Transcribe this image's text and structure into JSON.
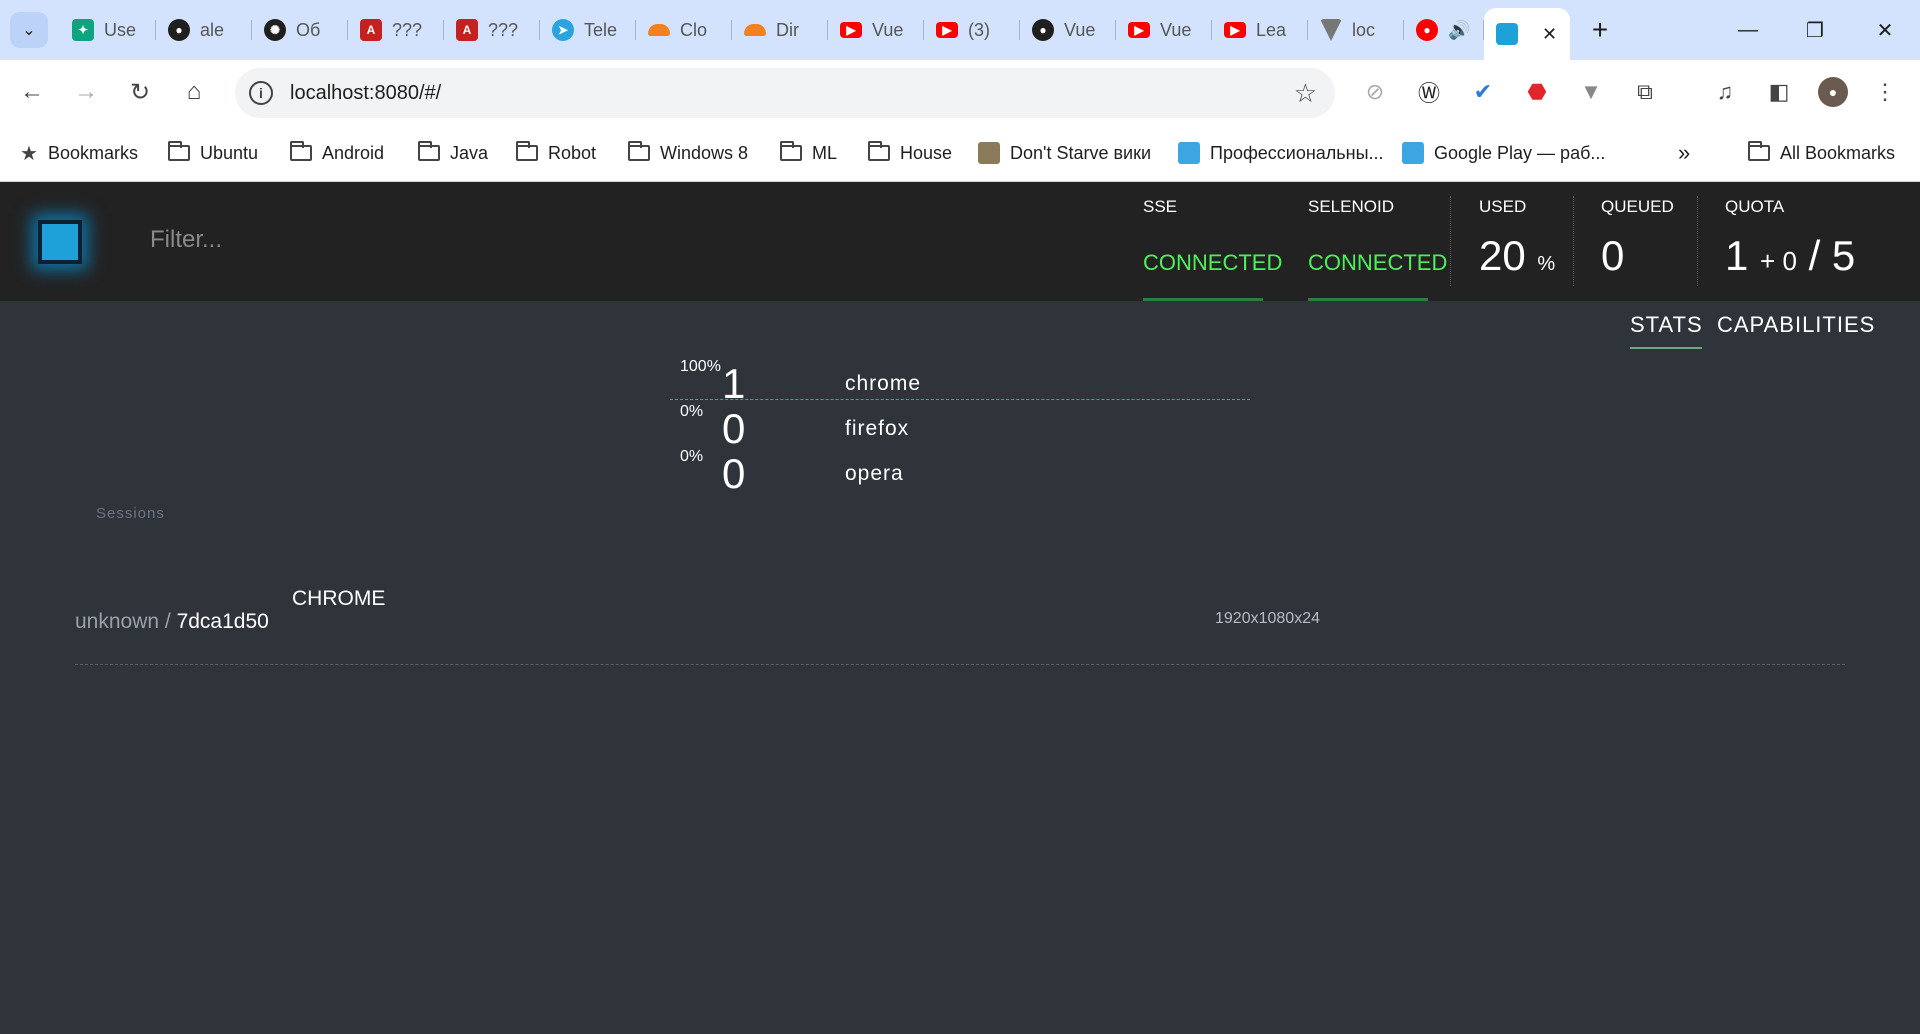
{
  "browser": {
    "tabs": [
      {
        "label": "Use",
        "icon": "chatgpt-icon",
        "color": "#10a37f"
      },
      {
        "label": "ale",
        "icon": "github-icon",
        "color": "#1f1f1f"
      },
      {
        "label": "Об",
        "icon": "openai-icon",
        "color": "#1f1f1f"
      },
      {
        "label": "???",
        "icon": "pdf-icon",
        "color": "#c5221f"
      },
      {
        "label": "???",
        "icon": "pdf-icon",
        "color": "#c5221f"
      },
      {
        "label": "Tele",
        "icon": "telegram-icon",
        "color": "#2aa3df"
      },
      {
        "label": "Clo",
        "icon": "cloudflare-icon",
        "color": "#f48120"
      },
      {
        "label": "Dir",
        "icon": "cloudflare-icon",
        "color": "#f48120"
      },
      {
        "label": "Vue",
        "icon": "youtube-icon",
        "color": "#ff0000"
      },
      {
        "label": "(3)",
        "icon": "youtube-icon",
        "color": "#ff0000"
      },
      {
        "label": "Vue",
        "icon": "github-icon",
        "color": "#1f1f1f"
      },
      {
        "label": "Vue",
        "icon": "youtube-icon",
        "color": "#ff0000"
      },
      {
        "label": "Lea",
        "icon": "youtube-icon",
        "color": "#ff0000"
      },
      {
        "label": "loc",
        "icon": "vuetify-icon",
        "color": "#777777"
      }
    ],
    "url": "localhost:8080/#/",
    "bookmarks_bar": {
      "bookmarks_label": "Bookmarks",
      "folders": [
        "Ubuntu",
        "Android",
        "Java",
        "Robot",
        "Windows 8",
        "ML",
        "House"
      ],
      "links": [
        "Don't Starve вики",
        "Профессиональны...",
        "Google Play — раб..."
      ],
      "all_bookmarks": "All Bookmarks"
    }
  },
  "app": {
    "filter_placeholder": "Filter...",
    "sse": {
      "title": "SSE",
      "status": "CONNECTED"
    },
    "selenoid": {
      "title": "SELENOID",
      "status": "CONNECTED"
    },
    "used": {
      "title": "USED",
      "value": "20",
      "unit": "%"
    },
    "queued": {
      "title": "QUEUED",
      "value": "0"
    },
    "quota": {
      "title": "QUOTA",
      "used": "1",
      "pending": "+ 0",
      "total": "/ 5"
    },
    "view_tabs": {
      "stats": "STATS",
      "capabilities": "CAPABILITIES"
    },
    "browsers": [
      {
        "pct": "100%",
        "count": "1",
        "name": "chrome"
      },
      {
        "pct": "0%",
        "count": "0",
        "name": "firefox"
      },
      {
        "pct": "0%",
        "count": "0",
        "name": "opera"
      }
    ],
    "sessions_label": "Sessions",
    "session": {
      "user": "unknown",
      "id": "7dca1d50",
      "browser": "CHROME",
      "screen": "1920x1080x24"
    },
    "colors": {
      "header_bg": "#222222",
      "page_bg": "#2f343b",
      "connected": "#4df05b",
      "logo": "#1da1d8"
    }
  }
}
